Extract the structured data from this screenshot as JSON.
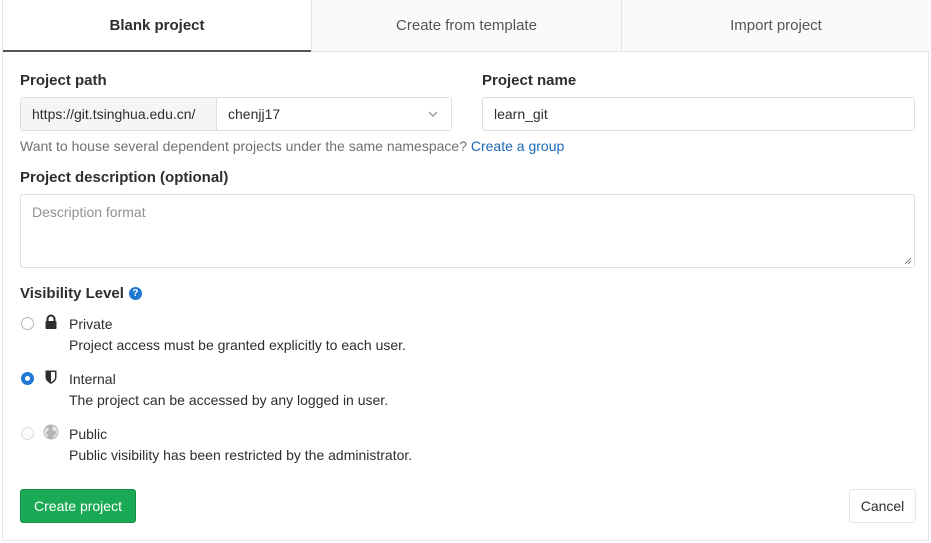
{
  "tabs": [
    {
      "label": "Blank project",
      "active": true
    },
    {
      "label": "Create from template",
      "active": false
    },
    {
      "label": "Import project",
      "active": false
    }
  ],
  "form": {
    "project_path_label": "Project path",
    "path_prefix": "https://git.tsinghua.edu.cn/",
    "namespace_value": "chenjj17",
    "project_name_label": "Project name",
    "project_name_value": "learn_git",
    "help_text": "Want to house several dependent projects under the same namespace?",
    "help_link": "Create a group",
    "description_label": "Project description (optional)",
    "description_placeholder": "Description format",
    "visibility_label": "Visibility Level",
    "visibility_help_icon": "question-circle-icon",
    "visibility_options": [
      {
        "title": "Private",
        "description": "Project access must be granted explicitly to each user.",
        "icon": "lock-icon",
        "checked": false,
        "disabled": false
      },
      {
        "title": "Internal",
        "description": "The project can be accessed by any logged in user.",
        "icon": "shield-icon",
        "checked": true,
        "disabled": false
      },
      {
        "title": "Public",
        "description": "Public visibility has been restricted by the administrator.",
        "icon": "globe-icon",
        "checked": false,
        "disabled": true
      }
    ]
  },
  "actions": {
    "create_label": "Create project",
    "cancel_label": "Cancel"
  },
  "colors": {
    "primary_green": "#1aaa55",
    "link_blue": "#1b69b6",
    "radio_blue": "#1f78d1"
  }
}
